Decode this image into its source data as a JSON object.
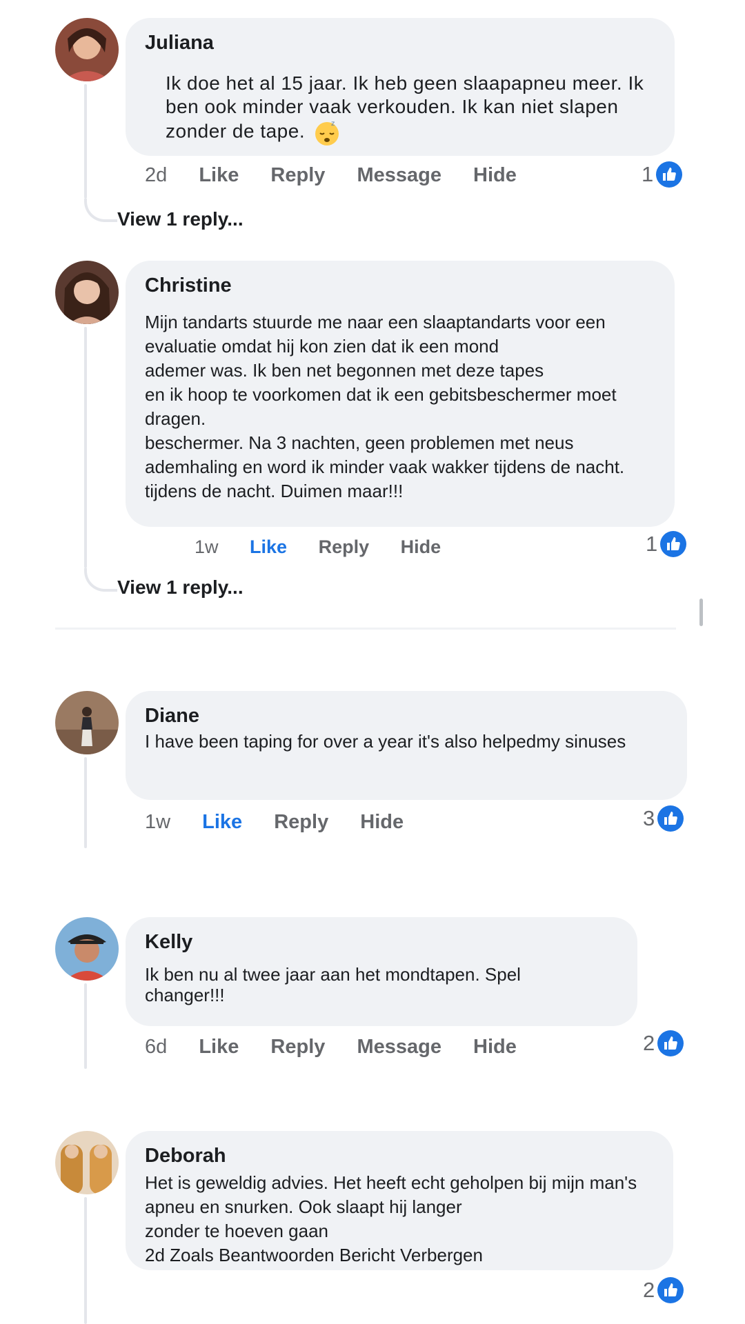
{
  "comments": [
    {
      "name": "Juliana",
      "text": "Ik doe het al 15 jaar. Ik heb geen slaapapneu meer. Ik\nben ook minder vaak verkouden. Ik kan niet slapen\nzonder de tape.",
      "emoji": "sleeping-face-emoji",
      "time": "2d",
      "actions": [
        "Like",
        "Reply",
        "Message",
        "Hide"
      ],
      "reactions": "1",
      "view_replies": "View 1 reply..."
    },
    {
      "name": "Christine",
      "text": "Mijn tandarts stuurde me naar een slaaptandarts voor een\nevaluatie omdat hij kon zien dat ik een mond\nademer was. Ik ben net begonnen met deze tapes\nen ik hoop te voorkomen dat ik een gebitsbeschermer moet\ndragen.\nbeschermer. Na 3 nachten, geen problemen met neus\nademhaling en word ik minder vaak wakker tijdens de nacht.\ntijdens de nacht. Duimen maar!!!",
      "time": "1w",
      "actions": [
        "Like",
        "Reply",
        "Hide"
      ],
      "liked": true,
      "reactions": "1",
      "view_replies": "View 1 reply..."
    },
    {
      "name": "Diane",
      "text": "I have been taping for over a year it's also helpedmy sinuses",
      "time": "1w",
      "actions": [
        "Like",
        "Reply",
        "Hide"
      ],
      "liked": true,
      "reactions": "3"
    },
    {
      "name": "Kelly",
      "text": "Ik ben nu al twee jaar aan het mondtapen. Spel\nchanger!!!",
      "time": "6d",
      "actions": [
        "Like",
        "Reply",
        "Message",
        "Hide"
      ],
      "reactions": "2"
    },
    {
      "name": "Deborah",
      "text": "Het is geweldig advies. Het heeft echt geholpen bij mijn man's\napneu en snurken. Ook slaapt hij langer\nzonder te hoeven gaan\n2d Zoals Beantwoorden Bericht Verbergen",
      "reactions": "2"
    }
  ],
  "colors": {
    "bubble": "#f0f2f5",
    "like_blue": "#1b74e4",
    "muted": "#65676b"
  }
}
